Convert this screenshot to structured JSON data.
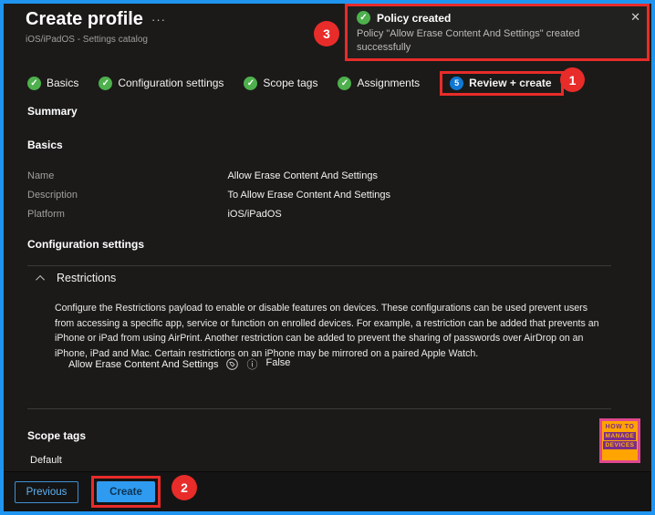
{
  "window": {
    "title": "Create profile",
    "subtitle": "iOS/iPadOS - Settings catalog",
    "ellipsis": "···"
  },
  "icons": {
    "check": "✓",
    "close": "✕",
    "info": "ⓘ"
  },
  "notification": {
    "title": "Policy created",
    "message": "Policy \"Allow Erase Content And Settings\" created successfully"
  },
  "steps": [
    {
      "label": "Basics",
      "state": "complete"
    },
    {
      "label": "Configuration settings",
      "state": "complete"
    },
    {
      "label": "Scope tags",
      "state": "complete"
    },
    {
      "label": "Assignments",
      "state": "complete"
    },
    {
      "label": "Review + create",
      "state": "current",
      "number": "5"
    }
  ],
  "summary": {
    "heading": "Summary",
    "basics": {
      "heading": "Basics",
      "rows": [
        {
          "label": "Name",
          "value": "Allow Erase Content And Settings"
        },
        {
          "label": "Description",
          "value": "To Allow Erase Content And Settings"
        },
        {
          "label": "Platform",
          "value": "iOS/iPadOS"
        }
      ]
    },
    "configuration": {
      "heading": "Configuration settings",
      "group": "Restrictions",
      "description": "Configure the Restrictions payload to enable or disable features on devices. These configurations can be used prevent users from accessing a specific app, service or function on enrolled devices. For example, a restriction can be added that prevents an iPhone or iPad from using AirPrint. Another restriction can be added to prevent the sharing of passwords over AirDrop on an iPhone, iPad and Mac. Certain restrictions on an iPhone may be mirrored on a paired Apple Watch.",
      "setting": {
        "label": "Allow Erase Content And Settings",
        "value": "False"
      }
    },
    "scope_tags": {
      "heading": "Scope tags",
      "value": "Default"
    }
  },
  "footer": {
    "previous_label": "Previous",
    "create_label": "Create"
  },
  "annotations": {
    "badge1": "1",
    "badge2": "2",
    "badge3": "3"
  },
  "watermark": {
    "line1": "HOW TO",
    "line2": "MANAGE",
    "line3": "DEVICES"
  },
  "colors": {
    "frame_blue": "#2095f0",
    "panel_bg": "#1b1a19",
    "annotation_red": "#e82c2a",
    "success_green": "#4db04c",
    "step_blue": "#0f78d4",
    "create_button_blue": "#2e9bf0",
    "label_gray": "#a19f9d"
  }
}
